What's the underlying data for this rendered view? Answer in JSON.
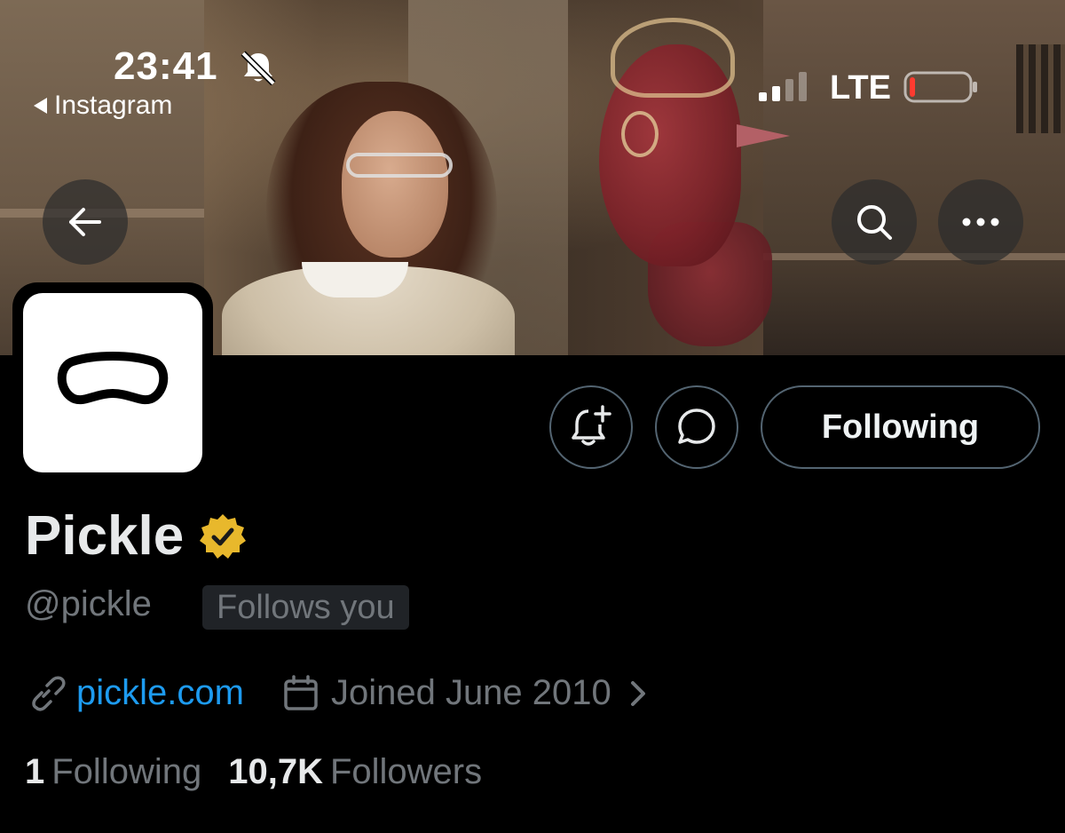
{
  "status_bar": {
    "time": "23:41",
    "back_app_label": "Instagram",
    "network": "LTE",
    "icons": [
      "bell-muted-icon",
      "signal-icon",
      "battery-icon"
    ],
    "battery_level": 0.1,
    "battery_color": "#ff3b30"
  },
  "header": {
    "buttons": [
      "back-arrow-icon",
      "search-icon",
      "more-icon"
    ]
  },
  "actions": {
    "notify_icon": "bell-plus-icon",
    "message_icon": "message-bubble-icon",
    "following_label": "Following"
  },
  "profile": {
    "display_name": "Pickle",
    "verified": true,
    "verified_color": "#e8b82c",
    "handle": "@pickle",
    "follows_you_label": "Follows you",
    "website": "pickle.com",
    "joined": "Joined June 2010",
    "following_count": "1",
    "following_label": "Following",
    "followers_count": "10,7K",
    "followers_label": "Followers"
  },
  "colors": {
    "background": "#000000",
    "link": "#1d9bf0",
    "muted_text": "#71767b",
    "primary_text": "#e7e9ea"
  }
}
